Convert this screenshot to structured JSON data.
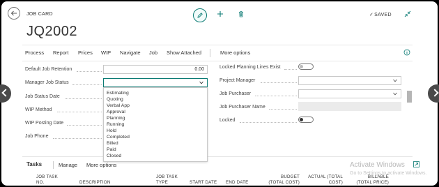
{
  "header": {
    "caption": "JOB CARD",
    "title": "JQ2002",
    "saved_label": "SAVED"
  },
  "actions": [
    "Process",
    "Report",
    "Prices",
    "WIP",
    "Navigate",
    "Job",
    "Show Attached",
    "More options"
  ],
  "left_fields": {
    "default_job_retention": {
      "label": "Default Job Retention",
      "value": "0.00"
    },
    "manager_job_status": {
      "label": "Manager Job Status",
      "value": ""
    },
    "job_status_date": {
      "label": "Job Status Date"
    },
    "wip_method": {
      "label": "WIP Method"
    },
    "wip_posting_date": {
      "label": "WIP Posting Date"
    },
    "job_phone": {
      "label": "Job Phone"
    }
  },
  "right_fields": {
    "locked_planning_lines_exist": {
      "label": "Locked Planning Lines Exist",
      "on": false
    },
    "project_manager": {
      "label": "Project Manager",
      "value": ""
    },
    "job_purchaser": {
      "label": "Job Purchaser",
      "value": ""
    },
    "job_purchaser_name": {
      "label": "Job Purchaser Name",
      "value": ""
    },
    "locked": {
      "label": "Locked",
      "on": true
    }
  },
  "status_options": [
    "Estimating",
    "Quoting",
    "Verbal App",
    "Approval",
    "Planning",
    "Running",
    "Hold",
    "Completed",
    "Billed",
    "Paid",
    "Closed"
  ],
  "tasks": {
    "title": "Tasks",
    "manage": "Manage",
    "more_options": "More options",
    "columns": [
      {
        "line1": "JOB TASK",
        "line2": "NO."
      },
      {
        "line1": "",
        "line2": "DESCRIPTION"
      },
      {
        "line1": "JOB TASK",
        "line2": "TYPE"
      },
      {
        "line1": "",
        "line2": "START DATE"
      },
      {
        "line1": "",
        "line2": "END DATE"
      },
      {
        "line1": "BUDGET",
        "line2": "(TOTAL COST)"
      },
      {
        "line1": "ACTUAL (TOTAL",
        "line2": "COST)"
      },
      {
        "line1": "BILLABLE",
        "line2": "(TOTAL PRICE)"
      }
    ]
  },
  "watermark": {
    "title": "Activate Windows",
    "subtitle": "Go to Settings to activate Windows."
  },
  "colors": {
    "accent": "#0a7a73",
    "background": "#ffffff",
    "frame": "#000000"
  },
  "icons": [
    "back-arrow-icon",
    "edit-pencil-icon",
    "plus-icon",
    "trash-icon",
    "check-icon",
    "collapse-icon",
    "info-icon",
    "chevron-down-icon",
    "expand-icon",
    "chevron-left-icon",
    "chevron-right-icon"
  ]
}
